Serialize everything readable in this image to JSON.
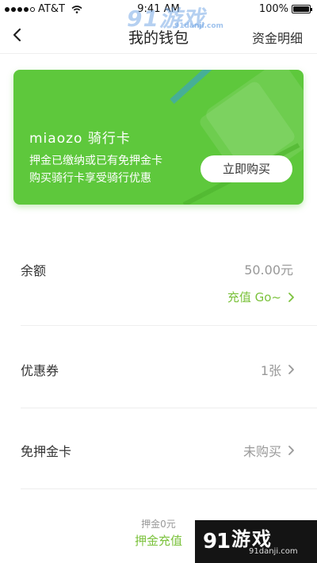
{
  "status_bar": {
    "carrier": "AT&T",
    "time": "9:41 AM",
    "battery": "100%",
    "battery_level": 1.0
  },
  "watermark_top": {
    "logo": "91游戏",
    "url": "91danji.com"
  },
  "nav": {
    "back_icon": "chevron-left-icon",
    "title": "我的钱包",
    "right_label": "资金明细"
  },
  "card": {
    "title": "miaozo 骑行卡",
    "line1": "押金已缴纳或已有免押金卡",
    "line2": "购买骑行卡享受骑行优惠",
    "button_label": "立即购买",
    "color": "#5ec83c"
  },
  "balance": {
    "label": "余额",
    "value": "50.00元",
    "recharge_label": "充值 Go~"
  },
  "coupon": {
    "label": "优惠券",
    "value": "1张"
  },
  "deposit_free_card": {
    "label": "免押金卡",
    "value": "未购买"
  },
  "footer": {
    "deposit_note": "押金0元",
    "deposit_link": "押金充值"
  },
  "watermark_bottom": {
    "logo": "游戏",
    "url": "91danji.com"
  },
  "colors": {
    "accent_green": "#7bc23c",
    "muted": "#999999"
  }
}
